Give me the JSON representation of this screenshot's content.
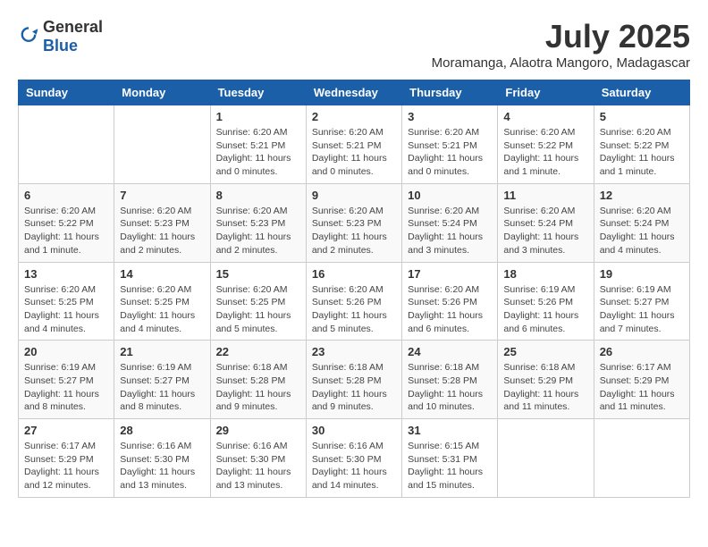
{
  "logo": {
    "general": "General",
    "blue": "Blue"
  },
  "header": {
    "month": "July 2025",
    "location": "Moramanga, Alaotra Mangoro, Madagascar"
  },
  "weekdays": [
    "Sunday",
    "Monday",
    "Tuesday",
    "Wednesday",
    "Thursday",
    "Friday",
    "Saturday"
  ],
  "weeks": [
    [
      {
        "day": "",
        "info": ""
      },
      {
        "day": "",
        "info": ""
      },
      {
        "day": "1",
        "info": "Sunrise: 6:20 AM\nSunset: 5:21 PM\nDaylight: 11 hours and 0 minutes."
      },
      {
        "day": "2",
        "info": "Sunrise: 6:20 AM\nSunset: 5:21 PM\nDaylight: 11 hours and 0 minutes."
      },
      {
        "day": "3",
        "info": "Sunrise: 6:20 AM\nSunset: 5:21 PM\nDaylight: 11 hours and 0 minutes."
      },
      {
        "day": "4",
        "info": "Sunrise: 6:20 AM\nSunset: 5:22 PM\nDaylight: 11 hours and 1 minute."
      },
      {
        "day": "5",
        "info": "Sunrise: 6:20 AM\nSunset: 5:22 PM\nDaylight: 11 hours and 1 minute."
      }
    ],
    [
      {
        "day": "6",
        "info": "Sunrise: 6:20 AM\nSunset: 5:22 PM\nDaylight: 11 hours and 1 minute."
      },
      {
        "day": "7",
        "info": "Sunrise: 6:20 AM\nSunset: 5:23 PM\nDaylight: 11 hours and 2 minutes."
      },
      {
        "day": "8",
        "info": "Sunrise: 6:20 AM\nSunset: 5:23 PM\nDaylight: 11 hours and 2 minutes."
      },
      {
        "day": "9",
        "info": "Sunrise: 6:20 AM\nSunset: 5:23 PM\nDaylight: 11 hours and 2 minutes."
      },
      {
        "day": "10",
        "info": "Sunrise: 6:20 AM\nSunset: 5:24 PM\nDaylight: 11 hours and 3 minutes."
      },
      {
        "day": "11",
        "info": "Sunrise: 6:20 AM\nSunset: 5:24 PM\nDaylight: 11 hours and 3 minutes."
      },
      {
        "day": "12",
        "info": "Sunrise: 6:20 AM\nSunset: 5:24 PM\nDaylight: 11 hours and 4 minutes."
      }
    ],
    [
      {
        "day": "13",
        "info": "Sunrise: 6:20 AM\nSunset: 5:25 PM\nDaylight: 11 hours and 4 minutes."
      },
      {
        "day": "14",
        "info": "Sunrise: 6:20 AM\nSunset: 5:25 PM\nDaylight: 11 hours and 4 minutes."
      },
      {
        "day": "15",
        "info": "Sunrise: 6:20 AM\nSunset: 5:25 PM\nDaylight: 11 hours and 5 minutes."
      },
      {
        "day": "16",
        "info": "Sunrise: 6:20 AM\nSunset: 5:26 PM\nDaylight: 11 hours and 5 minutes."
      },
      {
        "day": "17",
        "info": "Sunrise: 6:20 AM\nSunset: 5:26 PM\nDaylight: 11 hours and 6 minutes."
      },
      {
        "day": "18",
        "info": "Sunrise: 6:19 AM\nSunset: 5:26 PM\nDaylight: 11 hours and 6 minutes."
      },
      {
        "day": "19",
        "info": "Sunrise: 6:19 AM\nSunset: 5:27 PM\nDaylight: 11 hours and 7 minutes."
      }
    ],
    [
      {
        "day": "20",
        "info": "Sunrise: 6:19 AM\nSunset: 5:27 PM\nDaylight: 11 hours and 8 minutes."
      },
      {
        "day": "21",
        "info": "Sunrise: 6:19 AM\nSunset: 5:27 PM\nDaylight: 11 hours and 8 minutes."
      },
      {
        "day": "22",
        "info": "Sunrise: 6:18 AM\nSunset: 5:28 PM\nDaylight: 11 hours and 9 minutes."
      },
      {
        "day": "23",
        "info": "Sunrise: 6:18 AM\nSunset: 5:28 PM\nDaylight: 11 hours and 9 minutes."
      },
      {
        "day": "24",
        "info": "Sunrise: 6:18 AM\nSunset: 5:28 PM\nDaylight: 11 hours and 10 minutes."
      },
      {
        "day": "25",
        "info": "Sunrise: 6:18 AM\nSunset: 5:29 PM\nDaylight: 11 hours and 11 minutes."
      },
      {
        "day": "26",
        "info": "Sunrise: 6:17 AM\nSunset: 5:29 PM\nDaylight: 11 hours and 11 minutes."
      }
    ],
    [
      {
        "day": "27",
        "info": "Sunrise: 6:17 AM\nSunset: 5:29 PM\nDaylight: 11 hours and 12 minutes."
      },
      {
        "day": "28",
        "info": "Sunrise: 6:16 AM\nSunset: 5:30 PM\nDaylight: 11 hours and 13 minutes."
      },
      {
        "day": "29",
        "info": "Sunrise: 6:16 AM\nSunset: 5:30 PM\nDaylight: 11 hours and 13 minutes."
      },
      {
        "day": "30",
        "info": "Sunrise: 6:16 AM\nSunset: 5:30 PM\nDaylight: 11 hours and 14 minutes."
      },
      {
        "day": "31",
        "info": "Sunrise: 6:15 AM\nSunset: 5:31 PM\nDaylight: 11 hours and 15 minutes."
      },
      {
        "day": "",
        "info": ""
      },
      {
        "day": "",
        "info": ""
      }
    ]
  ]
}
